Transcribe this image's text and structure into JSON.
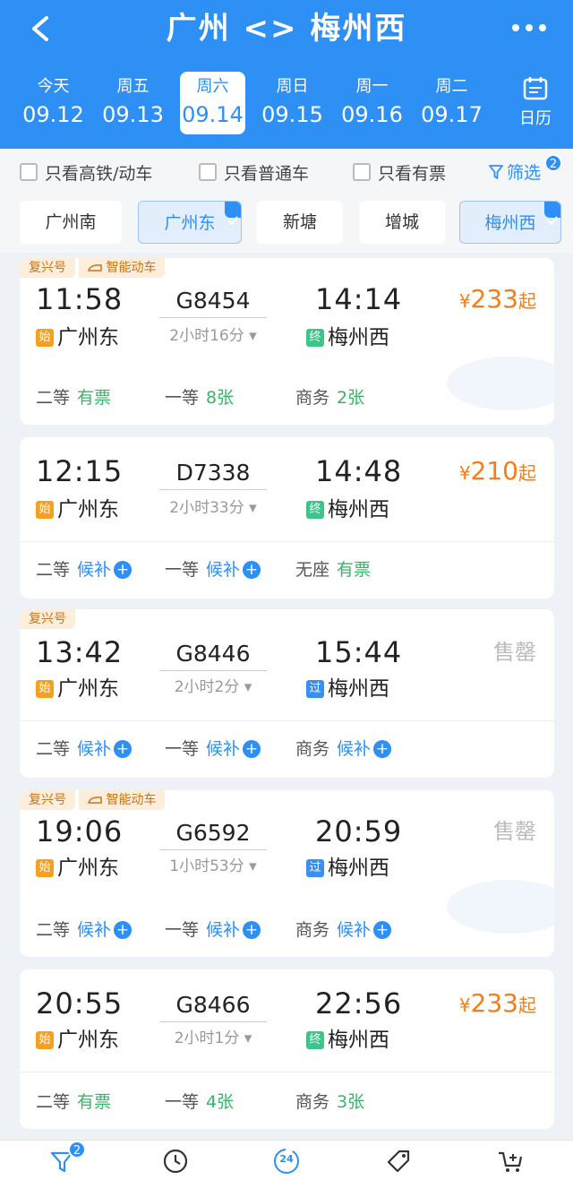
{
  "header": {
    "title": "广州 <> 梅州西",
    "dates": [
      {
        "weekday": "今天",
        "date": "09.12"
      },
      {
        "weekday": "周五",
        "date": "09.13"
      },
      {
        "weekday": "周六",
        "date": "09.14"
      },
      {
        "weekday": "周日",
        "date": "09.15"
      },
      {
        "weekday": "周一",
        "date": "09.16"
      },
      {
        "weekday": "周二",
        "date": "09.17"
      }
    ],
    "calendar_label": "日历"
  },
  "filters": {
    "high_speed": "只看高铁/动车",
    "regular": "只看普通车",
    "available": "只看有票",
    "filter": "筛选",
    "filter_count": "2"
  },
  "stations": [
    "广州南",
    "广州东",
    "新塘",
    "增城",
    "梅州西"
  ],
  "trains": [
    {
      "tags": [
        "复兴号",
        "智能动车"
      ],
      "dep_time": "11:58",
      "train_no": "G8454",
      "arr_time": "14:14",
      "duration": "2小时16分",
      "dep_badge": "始",
      "dep_station": "广州东",
      "arr_badge": "终",
      "arr_station": "梅州西",
      "price_cur": "¥",
      "price": "233",
      "price_suffix": "起",
      "seats": [
        {
          "name": "二等",
          "value": "有票"
        },
        {
          "name": "一等",
          "value": "8张"
        },
        {
          "name": "商务",
          "value": "2张"
        }
      ]
    },
    {
      "tags": [],
      "dep_time": "12:15",
      "train_no": "D7338",
      "arr_time": "14:48",
      "duration": "2小时33分",
      "dep_badge": "始",
      "dep_station": "广州东",
      "arr_badge": "终",
      "arr_station": "梅州西",
      "price_cur": "¥",
      "price": "210",
      "price_suffix": "起",
      "seats": [
        {
          "name": "二等",
          "value": "候补"
        },
        {
          "name": "一等",
          "value": "候补"
        },
        {
          "name": "无座",
          "value": "有票"
        }
      ]
    },
    {
      "tags": [
        "复兴号"
      ],
      "dep_time": "13:42",
      "train_no": "G8446",
      "arr_time": "15:44",
      "duration": "2小时2分",
      "dep_badge": "始",
      "dep_station": "广州东",
      "arr_badge": "过",
      "arr_station": "梅州西",
      "status": "售罄",
      "seats": [
        {
          "name": "二等",
          "value": "候补"
        },
        {
          "name": "一等",
          "value": "候补"
        },
        {
          "name": "商务",
          "value": "候补"
        }
      ]
    },
    {
      "tags": [
        "复兴号",
        "智能动车"
      ],
      "dep_time": "19:06",
      "train_no": "G6592",
      "arr_time": "20:59",
      "duration": "1小时53分",
      "dep_badge": "始",
      "dep_station": "广州东",
      "arr_badge": "过",
      "arr_station": "梅州西",
      "status": "售罄",
      "seats": [
        {
          "name": "二等",
          "value": "候补"
        },
        {
          "name": "一等",
          "value": "候补"
        },
        {
          "name": "商务",
          "value": "候补"
        }
      ]
    },
    {
      "tags": [],
      "dep_time": "20:55",
      "train_no": "G8466",
      "arr_time": "22:56",
      "duration": "2小时1分",
      "dep_badge": "始",
      "dep_station": "广州东",
      "arr_badge": "终",
      "arr_station": "梅州西",
      "price_cur": "¥",
      "price": "233",
      "price_suffix": "起",
      "seats": [
        {
          "name": "二等",
          "value": "有票"
        },
        {
          "name": "一等",
          "value": "4张"
        },
        {
          "name": "商务",
          "value": "3张"
        }
      ]
    }
  ],
  "bottom_bar": {
    "filter_badge": "2",
    "clock_text": "24"
  }
}
